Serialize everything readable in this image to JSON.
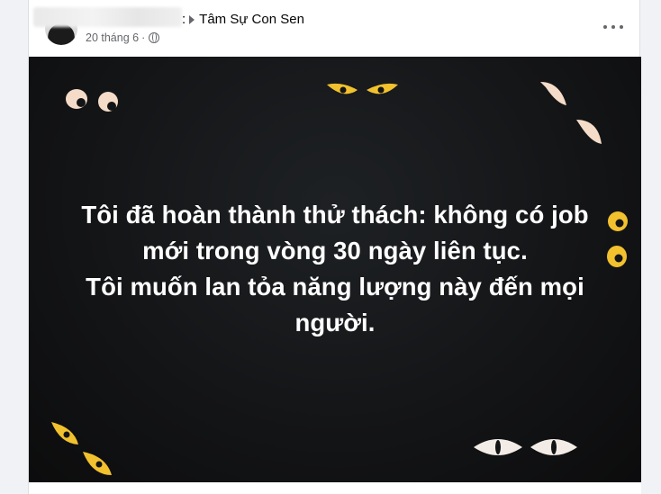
{
  "post": {
    "author": "Tâm Sự Con Sen",
    "author_prefix": ":",
    "date": "20 tháng 6",
    "date_separator": "·",
    "privacy_icon": "globe-icon",
    "more_icon": "more-options-icon",
    "image": {
      "background": "#131416",
      "lines": [
        "Tôi đã hoàn thành thử thách: không có job",
        "mới trong vòng 30 ngày liên tục.",
        "Tôi muốn lan tỏa năng lượng này đến mọi",
        "người."
      ]
    }
  },
  "colors": {
    "eye_cream": "#f5dcc8",
    "eye_yellow": "#f2c12e",
    "eye_white": "#f3ece6",
    "text_secondary": "#65676b"
  }
}
